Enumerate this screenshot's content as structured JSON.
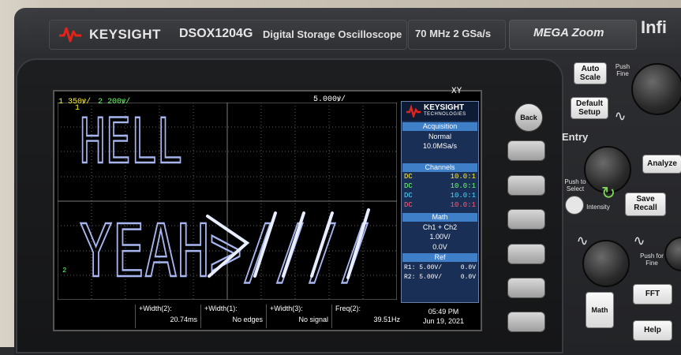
{
  "front_panel": {
    "brand": "KEYSIGHT",
    "model": "DSOX1204G",
    "model_desc": "Digital Storage Oscilloscope",
    "spec": "70 MHz  2 GSa/s",
    "megazoom": "MEGA Zoom",
    "series": "Infi"
  },
  "status": {
    "ch1_num": "1",
    "ch1_scale": "350ꝟ/",
    "ch2_num": "2",
    "ch2_scale": "200ꝟ/",
    "timebase": "5.000ꝟ/",
    "mode": "XY"
  },
  "screen_text": {
    "line1": "HELL",
    "line2": "YEAH>////"
  },
  "info_panel": {
    "logo_brand": "KEYSIGHT",
    "logo_sub": "TECHNOLOGIES",
    "acquisition_title": "Acquisition",
    "acq_mode": "Normal",
    "acq_rate": "10.0MSa/s",
    "channels_title": "Channels",
    "channels": [
      {
        "coupling": "DC",
        "probe": "10.0:1",
        "color": "#ffef30"
      },
      {
        "coupling": "DC",
        "probe": "10.0:1",
        "color": "#6bff6b"
      },
      {
        "coupling": "DC",
        "probe": "10.0:1",
        "color": "#4ad7ff"
      },
      {
        "coupling": "DC",
        "probe": "10.0:1",
        "color": "#ff5a7a"
      }
    ],
    "math_title": "Math",
    "math_fn": "Ch1 + Ch2",
    "math_scale": "1.00V/",
    "math_offset": "0.0V",
    "ref_title": "Ref",
    "refs": [
      {
        "name": "R1:",
        "scale": "5.00V/",
        "offset": "0.0V"
      },
      {
        "name": "R2:",
        "scale": "5.00V/",
        "offset": "0.0V"
      }
    ]
  },
  "measurements": [
    {
      "label": "+Width(2):",
      "value": "20.74ms"
    },
    {
      "label": "+Width(1):",
      "value": "No edges"
    },
    {
      "label": "+Width(3):",
      "value": "No signal"
    },
    {
      "label": "Freq(2):",
      "value": "39.51Hz"
    }
  ],
  "clock": {
    "time": "05:49 PM",
    "date": "Jun 19, 2021"
  },
  "controls": {
    "back": "Back",
    "auto_scale": "Auto Scale",
    "default_setup": "Default Setup",
    "push_fine": "Push Fine",
    "entry": "Entry",
    "push_select": "Push to Select",
    "intensity": "Intensity",
    "analyze": "Analyze",
    "save_recall": "Save Recall",
    "push_for_fine": "Push for Fine",
    "math": "Math",
    "fft": "FFT",
    "help": "Help"
  },
  "colors": {
    "trace": "#a8b6f0",
    "trace_hot": "#e8eeff",
    "panel_bg": "#1a2f55",
    "panel_header": "#3e7fc8",
    "brand_red": "#e2231a"
  }
}
